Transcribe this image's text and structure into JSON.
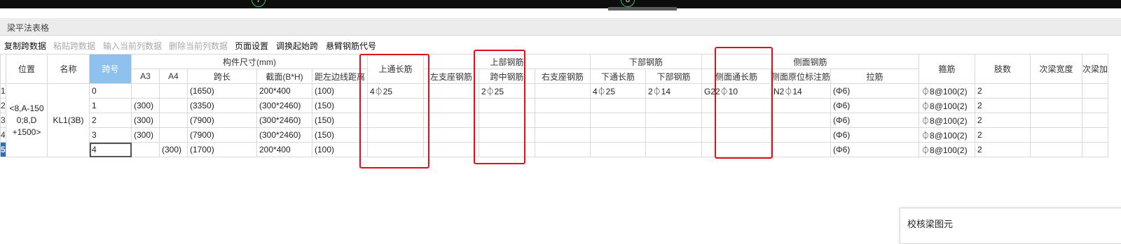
{
  "topbar": {
    "marker_left": "7",
    "marker_right": "8"
  },
  "panel": {
    "title": "梁平法表格"
  },
  "toolbar": {
    "copy_span": "复制跨数据",
    "paste_span": "粘贴跨数据",
    "input_column": "输入当前列数据",
    "delete_column": "删除当前列数据",
    "page_setup": "页面设置",
    "swap_start": "调换起始跨",
    "cantilever_code": "悬臂钢筋代号"
  },
  "table": {
    "groups": {
      "dims": "构件尺寸(mm)",
      "top_bars": "上部钢筋",
      "bottom_bars": "下部钢筋",
      "side_bars": "侧面钢筋"
    },
    "headers": {
      "position": "位置",
      "name": "名称",
      "span": "跨号",
      "a3": "A3",
      "a4": "A4",
      "span_len": "跨长",
      "section": "截面(B*H)",
      "offset": "距左边线距离",
      "top_cont": "上通长筋",
      "left_support": "左支座钢筋",
      "mid_span": "跨中钢筋",
      "right_support": "右支座钢筋",
      "bottom_cont": "下通长筋",
      "bottom_bar": "下部钢筋",
      "side_cont": "侧面通长筋",
      "side_orig": "侧面原位标注筋",
      "tie": "拉筋",
      "stirrup": "箍筋",
      "legs": "肢数",
      "sec_width": "次梁宽度",
      "sec_more": "次梁加"
    },
    "merged": {
      "position": "<8,A-150 0;8,D +1500>",
      "name": "KL1(3B)"
    },
    "rows": [
      {
        "rn": "1",
        "span": "0",
        "a3": "",
        "a4": "",
        "len": "(1650)",
        "section": "200*400",
        "offset": "(100)",
        "top_cont": "4⏀25",
        "left": "",
        "mid": "2⏀25",
        "right": "",
        "bot_cont": "4⏀25",
        "bot": "2⏀14",
        "side_cont": "G22⏀10",
        "side_orig": "N2⏀14",
        "tie": "(Φ6)",
        "stirrup": "⏀8@100(2)",
        "legs": "2",
        "sec_w": "",
        "sec_more": ""
      },
      {
        "rn": "2",
        "span": "1",
        "a3": "(300)",
        "a4": "",
        "len": "(3350)",
        "section": "(300*2460)",
        "offset": "(150)",
        "top_cont": "",
        "left": "",
        "mid": "",
        "right": "",
        "bot_cont": "",
        "bot": "",
        "side_cont": "",
        "side_orig": "",
        "tie": "(Φ6)",
        "stirrup": "⏀8@100(2)",
        "legs": "2",
        "sec_w": "",
        "sec_more": ""
      },
      {
        "rn": "3",
        "span": "2",
        "a3": "(300)",
        "a4": "",
        "len": "(7900)",
        "section": "(300*2460)",
        "offset": "(150)",
        "top_cont": "",
        "left": "",
        "mid": "",
        "right": "",
        "bot_cont": "",
        "bot": "",
        "side_cont": "",
        "side_orig": "",
        "tie": "(Φ6)",
        "stirrup": "⏀8@100(2)",
        "legs": "2",
        "sec_w": "",
        "sec_more": ""
      },
      {
        "rn": "4",
        "span": "3",
        "a3": "(300)",
        "a4": "",
        "len": "(7900)",
        "section": "(300*2460)",
        "offset": "(150)",
        "top_cont": "",
        "left": "",
        "mid": "",
        "right": "",
        "bot_cont": "",
        "bot": "",
        "side_cont": "",
        "side_orig": "",
        "tie": "(Φ6)",
        "stirrup": "⏀8@100(2)",
        "legs": "2",
        "sec_w": "",
        "sec_more": ""
      },
      {
        "rn": "5",
        "span": "4",
        "a3": "",
        "a4": "(300)",
        "len": "(1700)",
        "section": "200*400",
        "offset": "(100)",
        "top_cont": "",
        "left": "",
        "mid": "",
        "right": "",
        "bot_cont": "",
        "bot": "",
        "side_cont": "",
        "side_orig": "",
        "tie": "(Φ6)",
        "stirrup": "⏀8@100(2)",
        "legs": "2",
        "sec_w": "",
        "sec_more": ""
      }
    ]
  },
  "check_panel": {
    "title": "校核梁图元"
  },
  "colors": {
    "highlight": "#e0101a",
    "selected_header": "#8fc1ee",
    "selected_row": "#2f6db6"
  }
}
